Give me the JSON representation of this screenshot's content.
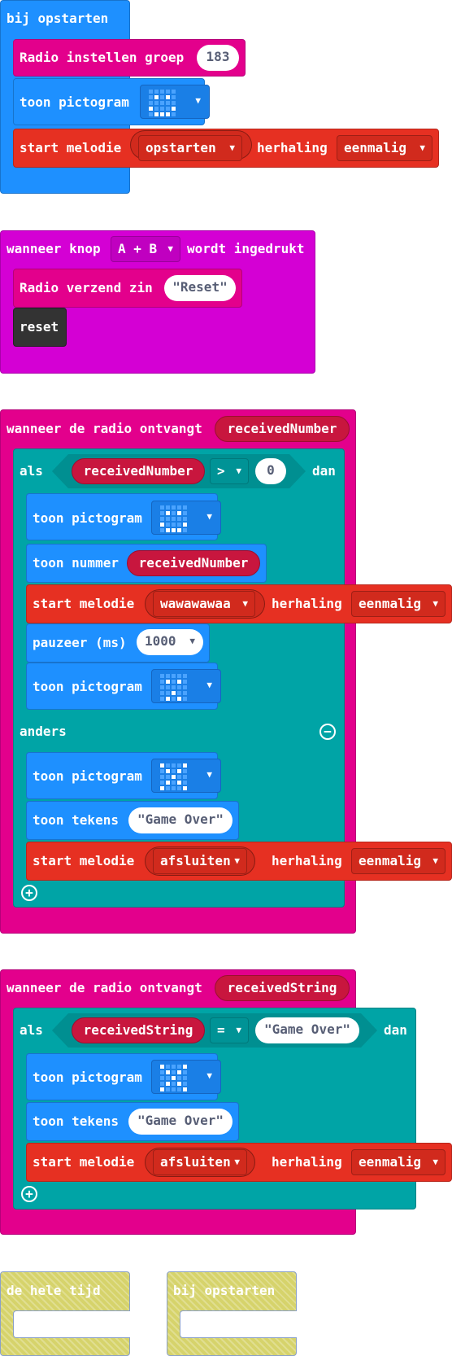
{
  "stack1": {
    "hat": "bij opstarten",
    "radio_group": "Radio instellen groep",
    "radio_group_value": "183",
    "show_icon": "toon pictogram",
    "melody_start": "start melodie",
    "melody_name": "opstarten",
    "repeat_label": "herhaling",
    "repeat_value": "eenmalig"
  },
  "stack2": {
    "hat_prefix": "wanneer knop",
    "button_value": "A + B",
    "hat_suffix": "wordt ingedrukt",
    "send_string": "Radio verzend zin",
    "send_value": "Reset",
    "reset": "reset"
  },
  "stack3": {
    "hat": "wanneer de radio ontvangt",
    "hat_var": "receivedNumber",
    "if": "als",
    "cond_var": "receivedNumber",
    "cond_op": ">",
    "cond_value": "0",
    "then": "dan",
    "show_icon_1": "toon pictogram",
    "show_number": "toon nummer",
    "show_number_var": "receivedNumber",
    "melody_start": "start melodie",
    "melody_name": "wawawawaa",
    "repeat_label": "herhaling",
    "repeat_value": "eenmalig",
    "pause": "pauzeer (ms)",
    "pause_value": "1000",
    "show_icon_2": "toon pictogram",
    "else": "anders",
    "show_icon_3": "toon pictogram",
    "show_string": "toon tekens",
    "show_string_value": "Game Over",
    "melody_start_2": "start melodie",
    "melody_name_2": "afsluiten",
    "repeat_label_2": "herhaling",
    "repeat_value_2": "eenmalig"
  },
  "stack4": {
    "hat": "wanneer de radio ontvangt",
    "hat_var": "receivedString",
    "if": "als",
    "cond_var": "receivedString",
    "cond_op": "=",
    "cond_value": "Game Over",
    "then": "dan",
    "show_icon": "toon pictogram",
    "show_string": "toon tekens",
    "show_string_value": "Game Over",
    "melody_start": "start melodie",
    "melody_name": "afsluiten",
    "repeat_label": "herhaling",
    "repeat_value": "eenmalig"
  },
  "ghosts": {
    "forever": "de hele tijd",
    "on_start": "bij opstarten"
  },
  "icons": {
    "dropdown": "caret-down-icon",
    "add": "plus-circle-icon",
    "remove": "minus-circle-icon",
    "led": "led-matrix-icon"
  },
  "led_patterns": {
    "happy": [
      [
        0,
        0,
        0,
        0,
        0
      ],
      [
        0,
        1,
        0,
        1,
        0
      ],
      [
        0,
        0,
        0,
        0,
        0
      ],
      [
        1,
        0,
        0,
        0,
        1
      ],
      [
        0,
        1,
        1,
        1,
        0
      ]
    ],
    "smile": [
      [
        0,
        0,
        0,
        0,
        0
      ],
      [
        0,
        1,
        0,
        1,
        0
      ],
      [
        0,
        0,
        0,
        0,
        0
      ],
      [
        1,
        0,
        0,
        0,
        1
      ],
      [
        0,
        1,
        1,
        1,
        0
      ]
    ],
    "surprised": [
      [
        0,
        0,
        0,
        0,
        0
      ],
      [
        0,
        1,
        0,
        1,
        0
      ],
      [
        0,
        0,
        0,
        0,
        0
      ],
      [
        0,
        0,
        1,
        0,
        0
      ],
      [
        0,
        1,
        0,
        1,
        0
      ]
    ],
    "cross": [
      [
        1,
        0,
        0,
        0,
        1
      ],
      [
        0,
        1,
        0,
        1,
        0
      ],
      [
        0,
        0,
        1,
        0,
        0
      ],
      [
        0,
        1,
        0,
        1,
        0
      ],
      [
        1,
        0,
        0,
        0,
        1
      ]
    ],
    "skull": [
      [
        0,
        1,
        1,
        1,
        0
      ],
      [
        1,
        0,
        1,
        0,
        1
      ],
      [
        1,
        1,
        1,
        1,
        1
      ],
      [
        0,
        1,
        1,
        1,
        0
      ],
      [
        0,
        1,
        1,
        1,
        0
      ]
    ]
  },
  "colors": {
    "basic": "#1e90ff",
    "radio": "#e3008c",
    "input": "#d400d4",
    "music": "#e63022",
    "logic": "#00a4a6",
    "variables": "#c8163e",
    "control": "#333333"
  }
}
